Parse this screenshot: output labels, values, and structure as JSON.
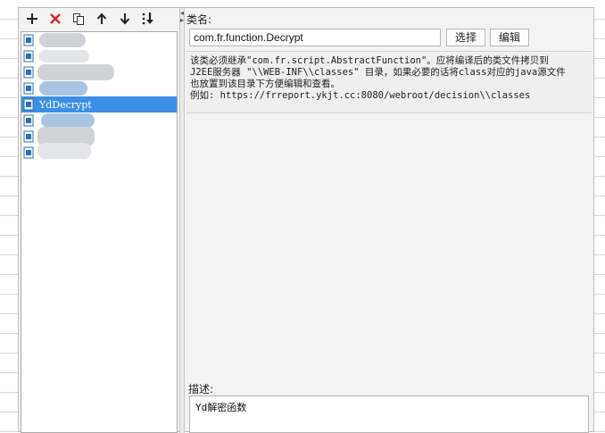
{
  "toolbar": {
    "add_icon": "plus-icon",
    "delete_icon": "delete-x-icon",
    "copy_icon": "copy-icon",
    "up_icon": "arrow-up-icon",
    "down_icon": "arrow-down-icon",
    "sort_icon": "sort-icon"
  },
  "function_list": {
    "items": [
      {
        "label": "",
        "selected": false
      },
      {
        "label": "",
        "selected": false
      },
      {
        "label": "",
        "selected": false
      },
      {
        "label": "",
        "selected": false
      },
      {
        "label": "YdDecrypt",
        "selected": true
      },
      {
        "label": "",
        "selected": false
      },
      {
        "label": "",
        "selected": false
      },
      {
        "label": "",
        "selected": false
      }
    ]
  },
  "form": {
    "class_name_label": "类名:",
    "class_name_value": "com.fr.function.Decrypt",
    "select_button": "选择",
    "edit_button": "编辑",
    "info_lines": [
      "该类必须继承\"com.fr.script.AbstractFunction\"。应将编译后的类文件拷贝到",
      "J2EE服务器 \"\\\\WEB-INF\\\\classes\" 目录，如果必要的话将class对应的java源文件",
      "也放置到该目录下方便编辑和查看。",
      "例如: https://frreport.ykjt.cc:8080/webroot/decision\\\\classes"
    ],
    "description_label": "描述:",
    "description_value": "Yd解密函数"
  },
  "colors": {
    "selection": "#3d8ee6",
    "delete_red": "#d9262c"
  }
}
